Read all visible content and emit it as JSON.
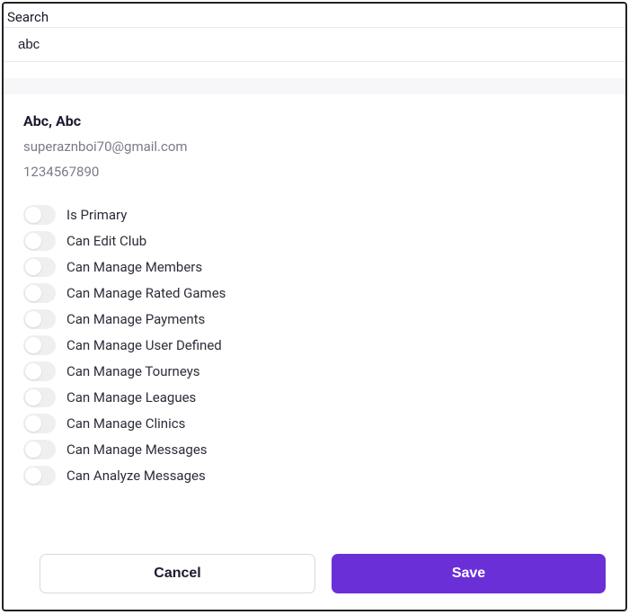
{
  "search": {
    "label": "Search",
    "value": "abc"
  },
  "user": {
    "name": "Abc, Abc",
    "email": "superaznboi70@gmail.com",
    "phone": "1234567890"
  },
  "permissions": [
    {
      "label": "Is Primary"
    },
    {
      "label": "Can Edit Club"
    },
    {
      "label": "Can Manage Members"
    },
    {
      "label": "Can Manage Rated Games"
    },
    {
      "label": "Can Manage Payments"
    },
    {
      "label": "Can Manage User Defined"
    },
    {
      "label": "Can Manage Tourneys"
    },
    {
      "label": "Can Manage Leagues"
    },
    {
      "label": "Can Manage Clinics"
    },
    {
      "label": "Can Manage Messages"
    },
    {
      "label": "Can Analyze Messages"
    }
  ],
  "buttons": {
    "cancel": "Cancel",
    "save": "Save"
  }
}
